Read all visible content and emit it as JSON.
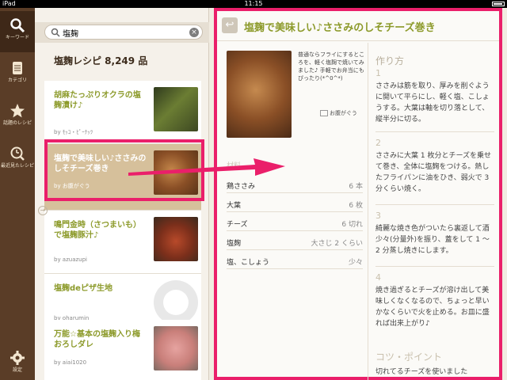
{
  "status": {
    "carrier": "iPad",
    "time": "11:15"
  },
  "sidebar": {
    "items": [
      {
        "label": "キーワード",
        "icon": "search-icon"
      },
      {
        "label": "カテゴリ",
        "icon": "category-icon"
      },
      {
        "label": "話題のレシピ",
        "icon": "star-icon"
      },
      {
        "label": "最近見たレシピ",
        "icon": "clock-icon"
      },
      {
        "label": "設定",
        "icon": "gear-icon"
      }
    ]
  },
  "search": {
    "value": "塩麹",
    "placeholder": ""
  },
  "list": {
    "count_label": "塩麹レシピ 8,249 品",
    "items": [
      {
        "title": "胡麻たっぷりオクラの塩麹漬け♪",
        "author": "by ﾓｯｺ・ﾋﾟｰﾅｯﾂ"
      },
      {
        "title": "塩麹で美味しい♪ささみのしそチーズ巻き",
        "author": "by お腹がぐう"
      },
      {
        "title": "鳴門金時（さつまいも）で塩麹豚汁♪",
        "author": "by azuazupi"
      },
      {
        "title": "塩麹deピザ生地",
        "author": "by oharumin"
      },
      {
        "title": "万能☆基本の塩麹入り梅おろしダレ",
        "author": "by aiai1020"
      }
    ]
  },
  "detail": {
    "title": "塩麹で美味しい♪ささみのしそチーズ巻き",
    "description": "普通ならフライにするところを、軽く塩麹で焼いてみました♪ 手軽でお弁当にもぴったり(*^0^*)",
    "author": "お腹がぐう",
    "ingredients_label": "材料",
    "ingredients": [
      {
        "name": "鶏ささみ",
        "qty": "6 本"
      },
      {
        "name": "大葉",
        "qty": "6 枚"
      },
      {
        "name": "チーズ",
        "qty": "6 切れ"
      },
      {
        "name": "塩麹",
        "qty": "大さじ 2 くらい"
      },
      {
        "name": "塩、こしょう",
        "qty": "少々"
      }
    ],
    "steps_label": "作り方",
    "steps": [
      {
        "num": "1",
        "text": "ささみは筋を取り、厚みを削ぐように開いて平らにし、軽く塩、こしょうする。大葉は軸を切り落として、縦半分に切る。"
      },
      {
        "num": "2",
        "text": "ささみに大葉 1 枚分とチーズを乗せて巻き、全体に塩麹をつける。熱したフライパンに油をひき、弱火で 3 分くらい焼く。"
      },
      {
        "num": "3",
        "text": "綺麗な焼き色がついたら裏返して酒少々(分量外)を振り、蓋をして 1 〜 2 分蒸し焼きにします。"
      },
      {
        "num": "4",
        "text": "焼き過ぎるとチーズが溶け出して美味しくなくなるので、ちょっと早いかなくらいで火を止める。お皿に盛れば出来上がり♪"
      }
    ],
    "tips_label": "コツ・ポイント",
    "tips_text": "切れてるチーズを使いました"
  },
  "colors": {
    "accent": "#8c9a2a",
    "highlight": "#ea1f6a",
    "sidebar": "#5a3d27"
  }
}
